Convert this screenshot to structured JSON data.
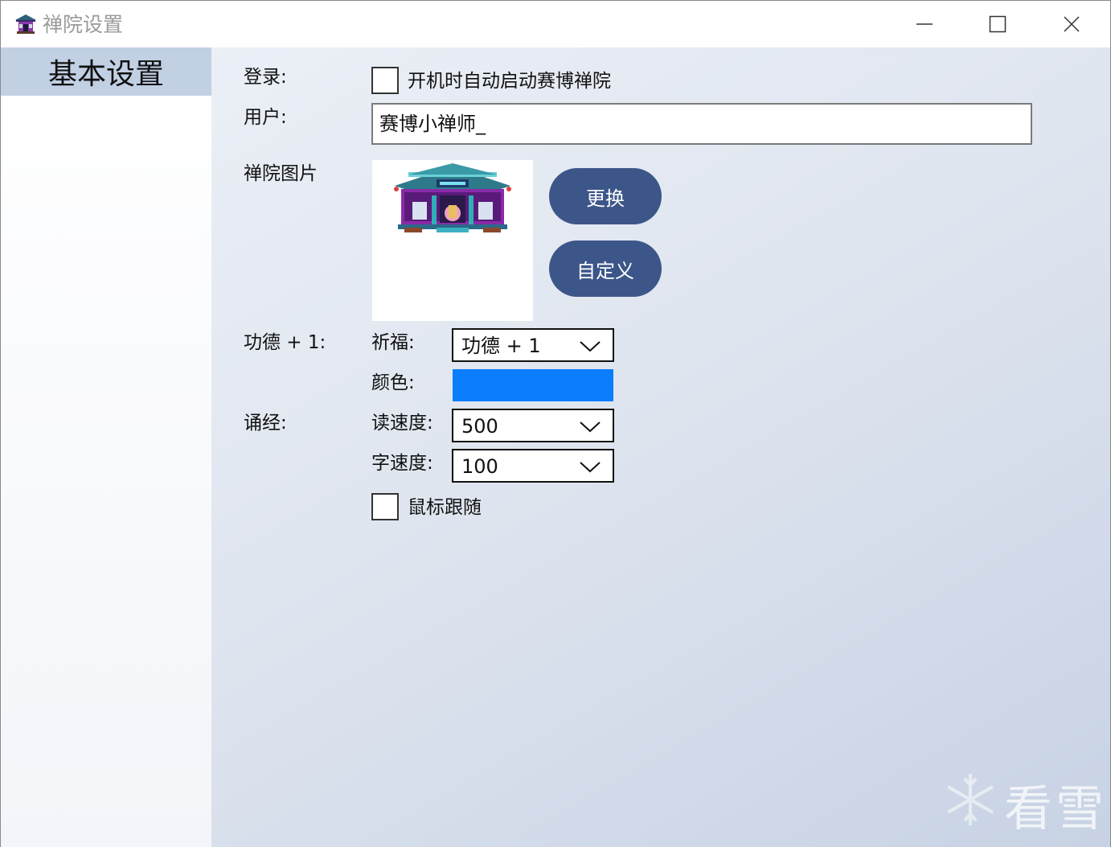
{
  "window": {
    "title": "禅院设置",
    "icon": "temple-icon",
    "controls": [
      "minimize-icon",
      "maximize-icon",
      "close-icon"
    ]
  },
  "sidebar": {
    "items": [
      {
        "label": "基本设置",
        "selected": true
      }
    ]
  },
  "login": {
    "label": "登录:",
    "autostart_label": "开机时自动启动赛博禅院",
    "autostart_checked": false
  },
  "user": {
    "label": "用户:",
    "value": "赛博小禅师_"
  },
  "temple_image": {
    "label": "禅院图片",
    "replace_button": "更换",
    "custom_button": "自定义"
  },
  "merit": {
    "label": "功德 + 1:",
    "pray_label": "祈福:",
    "pray_value": "功德 + 1",
    "color_label": "颜色:",
    "color": "#0a7efc"
  },
  "chant": {
    "label": "诵经:",
    "read_speed_label": "读速度:",
    "read_speed_value": "500",
    "char_speed_label": "字速度:",
    "char_speed_value": "100",
    "mouse_follow_label": "鼠标跟随",
    "mouse_follow_checked": false
  },
  "watermark": {
    "text": "看雪",
    "icon": "snowflake-icon"
  },
  "colors": {
    "accent_button": "#3c5689",
    "sidebar_selected": "#c2d0e4"
  }
}
